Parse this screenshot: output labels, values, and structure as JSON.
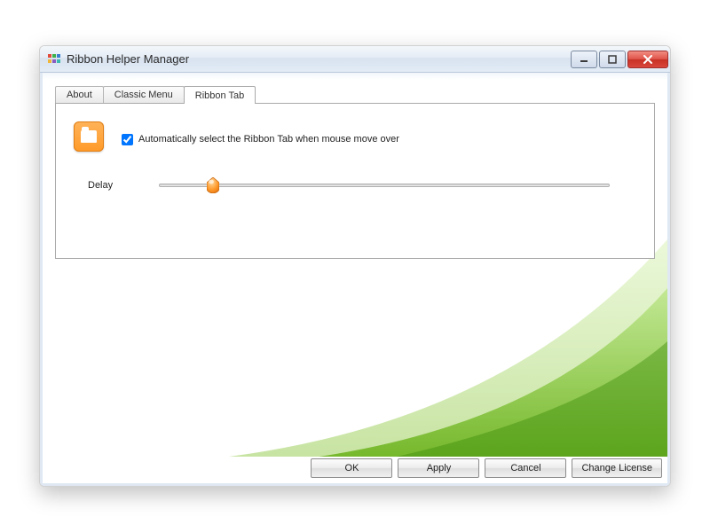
{
  "window": {
    "title": "Ribbon Helper Manager"
  },
  "tabs": [
    {
      "label": "About"
    },
    {
      "label": "Classic Menu"
    },
    {
      "label": "Ribbon Tab"
    }
  ],
  "active_tab_index": 2,
  "ribbon_tab_page": {
    "auto_select_label": "Automatically select the Ribbon Tab when mouse move over",
    "auto_select_checked": true,
    "delay_label": "Delay",
    "delay_percent": 12
  },
  "buttons": {
    "ok": "OK",
    "apply": "Apply",
    "cancel": "Cancel",
    "change_license": "Change License"
  }
}
